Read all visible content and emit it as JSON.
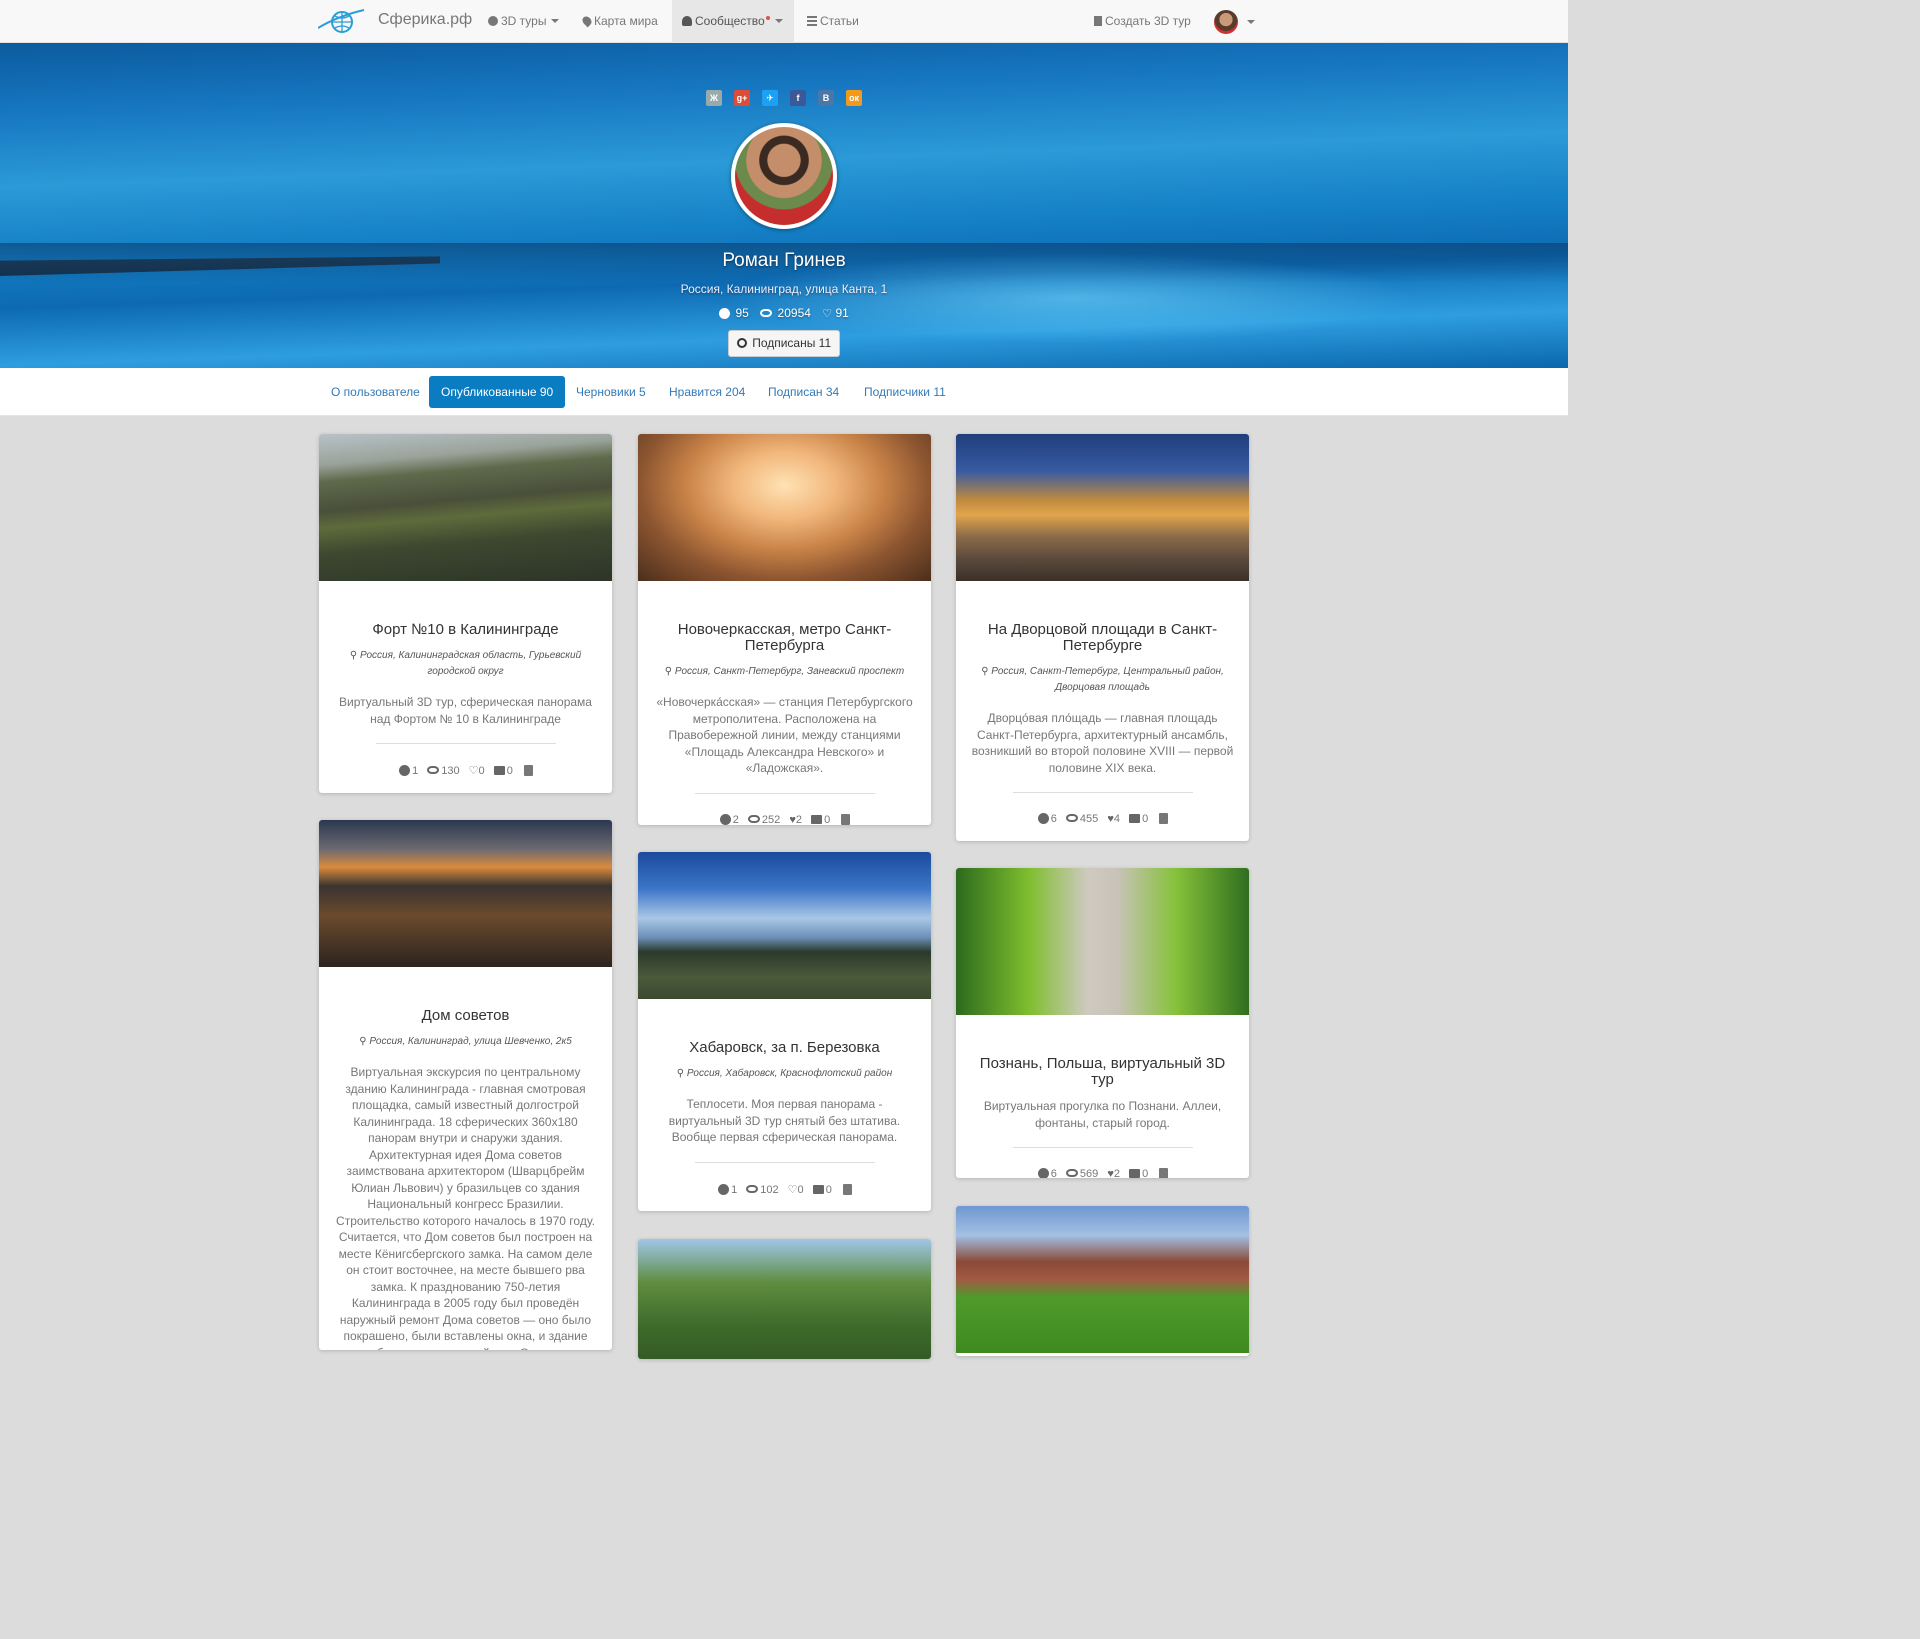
{
  "nav": {
    "brand": "Сферика.рф",
    "items": [
      {
        "label": "3D туры",
        "icon": "globe-icon",
        "dropdown": true
      },
      {
        "label": "Карта мира",
        "icon": "map-marker-icon",
        "dropdown": false
      },
      {
        "label": "Сообщество",
        "icon": "user-icon",
        "dropdown": true,
        "active": true,
        "notification": true
      },
      {
        "label": "Статьи",
        "icon": "list-icon",
        "dropdown": false
      }
    ],
    "create_label": "Создать 3D тур"
  },
  "profile": {
    "socials": [
      "Ж",
      "g+",
      "✈",
      "f",
      "В",
      "ок"
    ],
    "name": "Роман Гринев",
    "location": "Россия, Калининград, улица Канта, 1",
    "stats": {
      "tours": "95",
      "views": "20954",
      "likes": "91"
    },
    "follow_label": "Подписаны 11"
  },
  "tabs": [
    {
      "label": "О пользователе",
      "active": false
    },
    {
      "label": "Опубликованные 90",
      "active": true
    },
    {
      "label": "Черновики 5",
      "active": false
    },
    {
      "label": "Нравится 204",
      "active": false
    },
    {
      "label": "Подписан 34",
      "active": false
    },
    {
      "label": "Подписчики 11",
      "active": false
    }
  ],
  "cards": [
    {
      "title": "Форт №10 в Калининграде",
      "location": "Россия, Калининградская область, Гурьевский городской округ",
      "description": "Виртуальный 3D тур, сферическая панорама над Фортом № 10 в Калининграде",
      "stats": {
        "panoramas": "1",
        "views": "130",
        "likes": "0",
        "comments": "0"
      }
    },
    {
      "title": "Новочеркасская, метро Санкт-Петербурга",
      "location": "Россия, Санкт-Петербург, Заневский проспект",
      "description": "«Новочерка́сская» — станция Петербургского метрополитена. Расположена на Правобережной линии, между станциями «Площадь Александра Невского» и «Ладожская».",
      "stats": {
        "panoramas": "2",
        "views": "252",
        "likes": "2",
        "comments": "0"
      }
    },
    {
      "title": "На Дворцовой площади в Санкт-Петербурге",
      "location": "Россия, Санкт-Петербург, Центральный район, Дворцовая площадь",
      "description": "Дворцо́вая пло́щадь — главная площадь Санкт-Петербурга, архитектурный ансамбль, возникший во второй половине XVIII — первой половине XIX века.",
      "stats": {
        "panoramas": "6",
        "views": "455",
        "likes": "4",
        "comments": "0"
      }
    },
    {
      "title": "Дом советов",
      "location": "Россия, Калининград, улица Шевченко, 2к5",
      "description": "Виртуальная экскурсия по центральному зданию Калининграда - главная смотровая площадка, самый известный долгострой Калининграда. 18 сферических 360x180 панорам внутри и снаружи здания. Архитектурная идея Дома советов заимствована архитектором (Шварцбрейм Юлиан Львович) у бразильцев со здания Национальный конгресс Бразилии. Строительство которого началось в 1970 году. Считается, что Дом советов был построен на месте Кёнигсбергского замка. На самом деле он стоит восточнее, на месте бывшего рва замка. К празднованию 750-летия Калининграда в 2005 году был проведён наружный ремонт Дома советов — оно было покрашено, были вставлены окна, и здание приобрело современный вид. Однако и в настоящий момент будущее Дома",
      "stats": {
        "panoramas": "",
        "views": "",
        "likes": "",
        "comments": ""
      }
    },
    {
      "title": "Хабаровск, за п. Березовка",
      "location": "Россия, Хабаровск, Краснофлотский район",
      "description": "Теплосети. Моя первая панорама - виртуальный 3D тур снятый без штатива. Вообще первая сферическая панорама.",
      "stats": {
        "panoramas": "1",
        "views": "102",
        "likes": "0",
        "comments": "0"
      }
    },
    {
      "title": "Познань, Польша, виртуальный 3D тур",
      "location": "",
      "description": "Виртуальная прогулка по Познани. Аллеи, фонтаны, старый город.",
      "stats": {
        "panoramas": "6",
        "views": "569",
        "likes": "2",
        "comments": "0"
      }
    }
  ]
}
